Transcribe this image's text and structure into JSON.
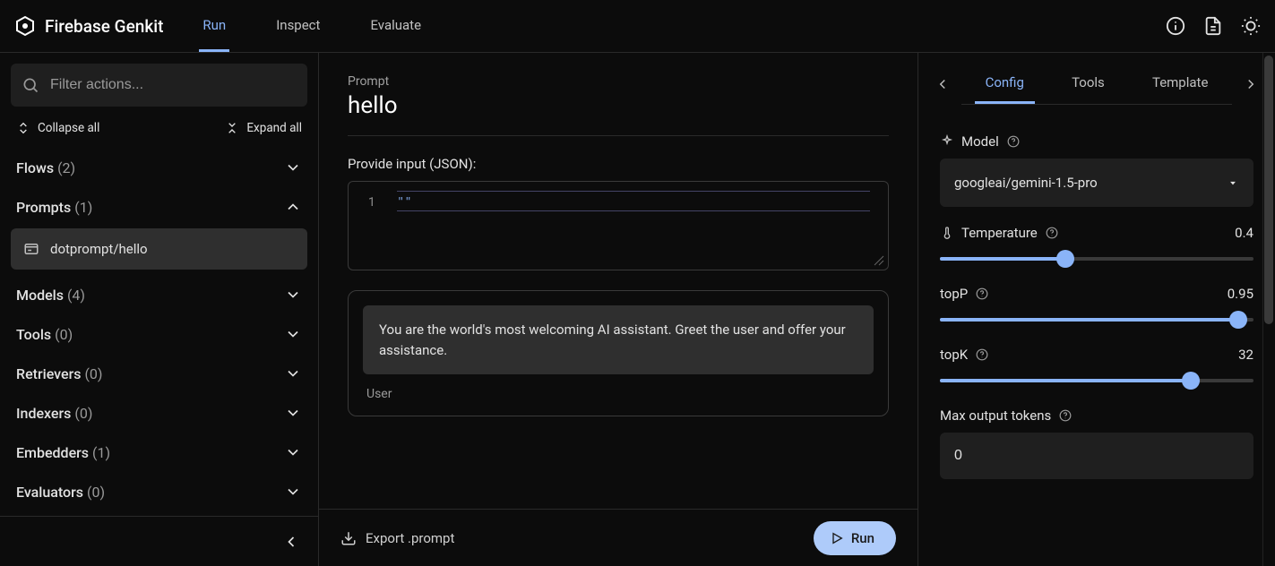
{
  "brand": {
    "title": "Firebase Genkit"
  },
  "top_tabs": {
    "run": "Run",
    "inspect": "Inspect",
    "evaluate": "Evaluate"
  },
  "top_icons": {
    "info": "info-icon",
    "doc": "document-icon",
    "theme": "sun-icon"
  },
  "sidebar": {
    "filter_placeholder": "Filter actions...",
    "collapse_all": "Collapse all",
    "expand_all": "Expand all",
    "sections": [
      {
        "label": "Flows",
        "count": "(2)",
        "expanded": false
      },
      {
        "label": "Prompts",
        "count": "(1)",
        "expanded": true,
        "items": [
          {
            "label": "dotprompt/hello",
            "selected": true
          }
        ]
      },
      {
        "label": "Models",
        "count": "(4)",
        "expanded": false
      },
      {
        "label": "Tools",
        "count": "(0)",
        "expanded": false
      },
      {
        "label": "Retrievers",
        "count": "(0)",
        "expanded": false
      },
      {
        "label": "Indexers",
        "count": "(0)",
        "expanded": false
      },
      {
        "label": "Embedders",
        "count": "(1)",
        "expanded": false
      },
      {
        "label": "Evaluators",
        "count": "(0)",
        "expanded": false
      }
    ]
  },
  "center": {
    "breadcrumb": "Prompt",
    "title": "hello",
    "input_label": "Provide input (JSON):",
    "code_line_no": "1",
    "code_content": "\"\"",
    "message_body": "You are the world's most welcoming AI assistant. Greet the user and offer your assistance.",
    "message_role": "User",
    "export_label": "Export .prompt",
    "run_label": "Run"
  },
  "right": {
    "tabs": {
      "config": "Config",
      "tools": "Tools",
      "template": "Template"
    },
    "model_label": "Model",
    "model_value": "googleai/gemini-1.5-pro",
    "temperature_label": "Temperature",
    "temperature_value": "0.4",
    "temperature_pct": 40,
    "topP_label": "topP",
    "topP_value": "0.95",
    "topP_pct": 95,
    "topK_label": "topK",
    "topK_value": "32",
    "topK_pct": 80,
    "max_tokens_label": "Max output tokens",
    "max_tokens_value": "0"
  }
}
